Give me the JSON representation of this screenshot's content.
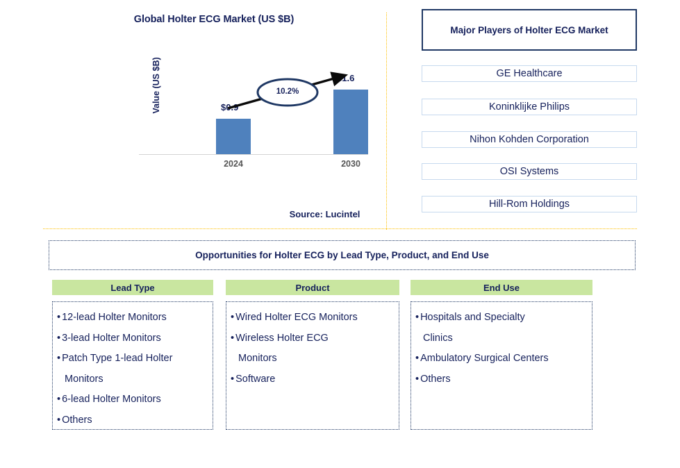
{
  "chart_data": {
    "type": "bar",
    "title": "Global Holter ECG Market (US $B)",
    "xlabel": "",
    "ylabel": "Value (US $B)",
    "categories": [
      "2024",
      "2030"
    ],
    "values": [
      0.9,
      1.6
    ],
    "value_labels": [
      "$0.9",
      "$1.6"
    ],
    "ylim": [
      0,
      1.75
    ],
    "grid": false,
    "legend": "none",
    "annotation": "10.2%",
    "annotation_type": "CAGR ellipse with arrow",
    "bar_color": "#4F81BD",
    "source": "Source: Lucintel"
  },
  "chart": {
    "title": "Global Holter ECG Market (US $B)",
    "y_axis_label": "Value (US $B)",
    "bars": [
      {
        "category": "2024",
        "label": "$0.9"
      },
      {
        "category": "2030",
        "label": "$1.6"
      }
    ],
    "cagr": "10.2%",
    "source": "Source: Lucintel"
  },
  "players": {
    "header": "Major Players of Holter ECG Market",
    "items": [
      "GE Healthcare",
      "Koninklijke Philips",
      "Nihon Kohden Corporation",
      "OSI Systems",
      "Hill-Rom Holdings"
    ]
  },
  "opportunities": {
    "banner": "Opportunities for Holter ECG by Lead Type, Product, and End Use",
    "columns": [
      {
        "header": "Lead Type",
        "items": [
          {
            "text": "12-lead Holter Monitors"
          },
          {
            "text": "3-lead Holter Monitors"
          },
          {
            "text": "Patch Type 1-lead Holter",
            "continuation": "Monitors"
          },
          {
            "text": "6-lead Holter Monitors"
          },
          {
            "text": "Others"
          }
        ]
      },
      {
        "header": "Product",
        "items": [
          {
            "text": "Wired Holter ECG Monitors"
          },
          {
            "text": "Wireless Holter ECG",
            "continuation": "Monitors"
          },
          {
            "text": "Software"
          }
        ]
      },
      {
        "header": "End Use",
        "items": [
          {
            "text": "Hospitals and Specialty",
            "continuation": "Clinics"
          },
          {
            "text": "Ambulatory Surgical Centers"
          },
          {
            "text": "Others"
          }
        ]
      }
    ]
  },
  "colors": {
    "bar": "#4F81BD",
    "navy": "#15205B",
    "header_green": "#C9E6A0",
    "divider_orange": "#FFC000",
    "player_border": "#C6D9EE"
  }
}
